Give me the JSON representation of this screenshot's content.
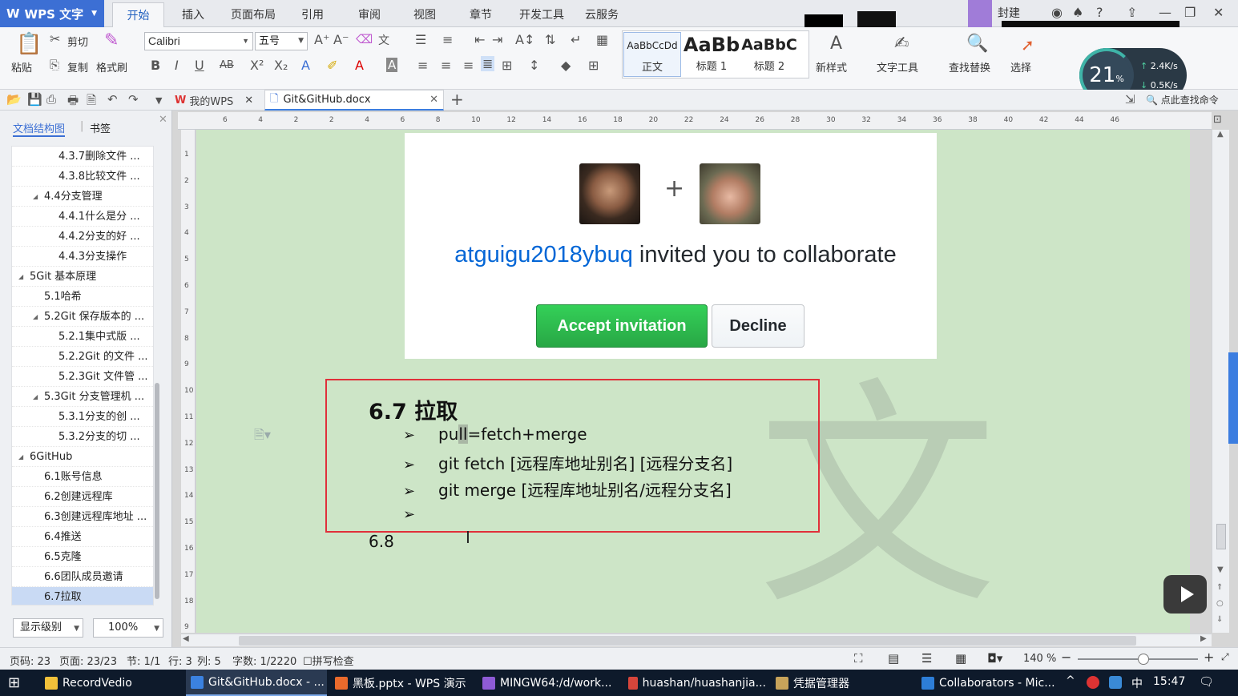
{
  "app": {
    "name": "WPS 文字",
    "menu_tabs": [
      "开始",
      "插入",
      "页面布局",
      "引用",
      "审阅",
      "视图",
      "章节",
      "开发工具",
      "云服务"
    ],
    "active_tab": "开始",
    "login_label": "封建",
    "minimize": "—",
    "maximize": "❐",
    "close": "✕"
  },
  "ribbon": {
    "paste": "粘贴",
    "cut": "剪切",
    "copy": "复制",
    "format_painter": "格式刷",
    "font_name": "Calibri",
    "font_size": "五号",
    "styles": [
      {
        "preview": "AaBbCcDd",
        "caption": "正文"
      },
      {
        "preview": "AaBb",
        "caption": "标题 1"
      },
      {
        "preview": "AaBbC",
        "caption": "标题 2"
      }
    ],
    "new_style": "新样式",
    "text_tools": "文字工具",
    "find_replace": "查找替换",
    "select": "选择"
  },
  "gauge": {
    "percent": "21",
    "unit": "%",
    "upload": "2.4K/s",
    "download": "0.5K/s"
  },
  "doc_tabs": {
    "mywps": "我的WPS",
    "file": "Git&GitHub.docx",
    "add": "+",
    "search_cmd": "点此查找命令"
  },
  "nav": {
    "tabs": [
      "文档结构图",
      "书签"
    ],
    "items": [
      {
        "label": "4.3.7删除文件 ...",
        "level": 3
      },
      {
        "label": "4.3.8比较文件 ...",
        "level": 3
      },
      {
        "label": "4.4分支管理",
        "level": 2,
        "expand": true
      },
      {
        "label": "4.4.1什么是分 ...",
        "level": 3
      },
      {
        "label": "4.4.2分支的好 ...",
        "level": 3
      },
      {
        "label": "4.4.3分支操作",
        "level": 3
      },
      {
        "label": "5Git 基本原理",
        "level": 1,
        "expand": true
      },
      {
        "label": "5.1哈希",
        "level": 2
      },
      {
        "label": "5.2Git 保存版本的 ...",
        "level": 2,
        "expand": true
      },
      {
        "label": "5.2.1集中式版 ...",
        "level": 3
      },
      {
        "label": "5.2.2Git 的文件 ...",
        "level": 3
      },
      {
        "label": "5.2.3Git 文件管 ...",
        "level": 3
      },
      {
        "label": "5.3Git 分支管理机 ...",
        "level": 2,
        "expand": true
      },
      {
        "label": "5.3.1分支的创 ...",
        "level": 3
      },
      {
        "label": "5.3.2分支的切 ...",
        "level": 3
      },
      {
        "label": "6GitHub",
        "level": 1,
        "expand": true
      },
      {
        "label": "6.1账号信息",
        "level": 2
      },
      {
        "label": "6.2创建远程库",
        "level": 2
      },
      {
        "label": "6.3创建远程库地址 ...",
        "level": 2
      },
      {
        "label": "6.4推送",
        "level": 2
      },
      {
        "label": "6.5克隆",
        "level": 2
      },
      {
        "label": "6.6团队成员邀请",
        "level": 2
      },
      {
        "label": "6.7拉取",
        "level": 2,
        "selected": true
      }
    ],
    "display_level": "显示级别",
    "zoom": "100%"
  },
  "ruler": {
    "h_labels": [
      "6",
      "4",
      "2",
      "2",
      "4",
      "6",
      "8",
      "10",
      "12",
      "14",
      "16",
      "18",
      "20",
      "22",
      "24",
      "26",
      "28",
      "30",
      "32",
      "34",
      "36",
      "38",
      "40",
      "42",
      "44",
      "46"
    ],
    "v_labels": [
      "1",
      "2",
      "3",
      "4",
      "5",
      "6",
      "7",
      "8",
      "9",
      "10",
      "11",
      "12",
      "13",
      "14",
      "15",
      "16",
      "17",
      "18",
      "9"
    ]
  },
  "document": {
    "invite": {
      "plus": "+",
      "user": "atguigu2018ybuq",
      "text": " invited you to collaborate",
      "accept": "Accept invitation",
      "decline": "Decline"
    },
    "section_title": "6.7 拉取",
    "bullets": [
      {
        "pre": "pu",
        "highlight": "ll",
        "post": "=fetch+merge"
      },
      {
        "pre": "git fetch [远程库地址别名] [远程分支名]",
        "highlight": "",
        "post": ""
      },
      {
        "pre": "git merge [远程库地址别名/远程分支名]",
        "highlight": "",
        "post": ""
      },
      {
        "pre": "",
        "highlight": "",
        "post": ""
      }
    ],
    "bullet_glyph": "➢",
    "next_section": "6.8",
    "watermark": "文"
  },
  "status": {
    "page_code": "页码: 23",
    "page": "页面: 23/23",
    "section": "节: 1/1",
    "line": "行: 3",
    "col": "列: 5",
    "word_count": "字数: 1/2220",
    "spell": "拼写检查",
    "zoom": "140 %"
  },
  "taskbar": {
    "items": [
      {
        "label": "RecordVedio",
        "color": "#f2c13a"
      },
      {
        "label": "Git&GitHub.docx - ...",
        "color": "#3b82e0",
        "active": true
      },
      {
        "label": "黑板.pptx - WPS 演示",
        "color": "#e96a2c"
      },
      {
        "label": "MINGW64:/d/work...",
        "color": "#8e5bd6"
      },
      {
        "label": "huashan/huashanjia...",
        "color": "#d6453b"
      },
      {
        "label": "凭据管理器",
        "color": "#c7a35a"
      },
      {
        "label": "Collaborators - Mic...",
        "color": "#2d7ed8"
      }
    ],
    "ime": "中",
    "time": "15:47"
  }
}
